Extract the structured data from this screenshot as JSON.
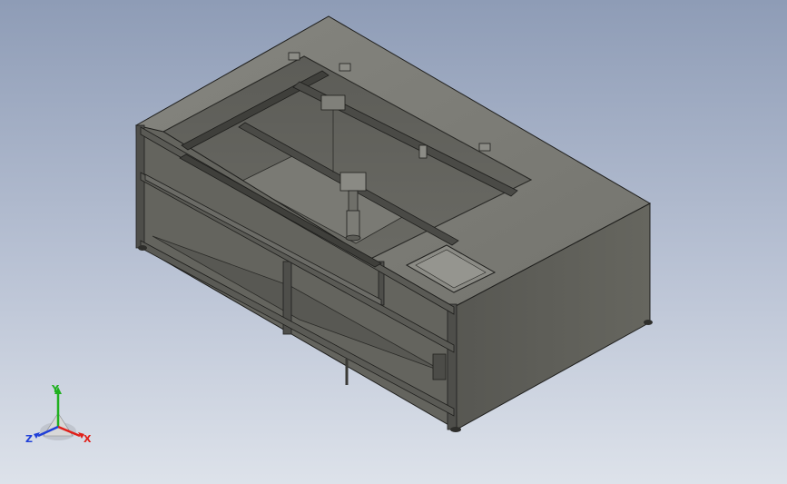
{
  "viewport": {
    "background_top": "#8e9cb6",
    "background_bottom": "#dde2ea"
  },
  "model": {
    "name": "",
    "render_style": "shaded-with-edges",
    "body_color": "#6e6e68",
    "top_color": "#7d7d77",
    "side_color": "#5e5e58",
    "frame_color": "#4a4a46",
    "edge_color": "#1e1e1c"
  },
  "triad": {
    "y_label": "Y",
    "x_label": "X",
    "z_label": "Z",
    "x_color": "#e0201a",
    "y_color": "#1fb01f",
    "z_color": "#2040d8"
  }
}
